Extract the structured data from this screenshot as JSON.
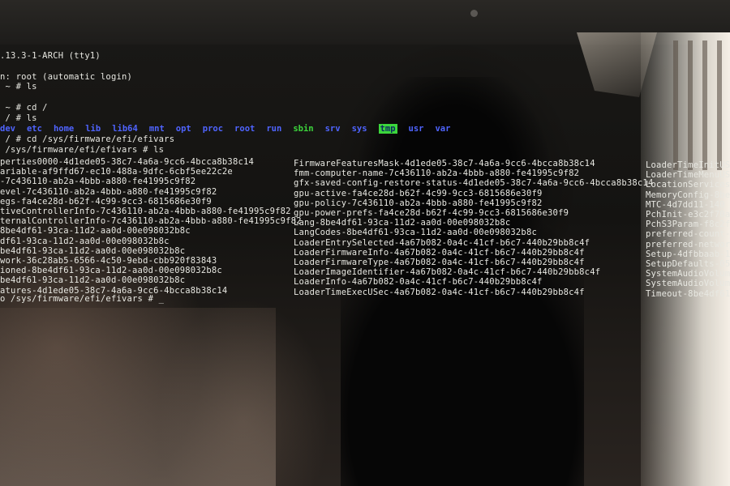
{
  "terminal": {
    "header": [
      ".13.3-1-ARCH (tty1)",
      "n: root (automatic login)",
      " ~ # ls",
      " ~ # cd /",
      " / # ls"
    ],
    "root_listing": [
      {
        "name": "dev",
        "kind": "dir"
      },
      {
        "name": "etc",
        "kind": "dir"
      },
      {
        "name": "home",
        "kind": "dir"
      },
      {
        "name": "lib",
        "kind": "dir"
      },
      {
        "name": "lib64",
        "kind": "dir"
      },
      {
        "name": "mnt",
        "kind": "dir"
      },
      {
        "name": "opt",
        "kind": "dir"
      },
      {
        "name": "proc",
        "kind": "dir"
      },
      {
        "name": "root",
        "kind": "dir"
      },
      {
        "name": "run",
        "kind": "dir"
      },
      {
        "name": "sbin",
        "kind": "exec"
      },
      {
        "name": "srv",
        "kind": "dir"
      },
      {
        "name": "sys",
        "kind": "dir"
      },
      {
        "name": "tmp",
        "kind": "tmp"
      },
      {
        "name": "usr",
        "kind": "dir"
      },
      {
        "name": "var",
        "kind": "dir"
      }
    ],
    "cd_efivars": " / # cd /sys/firmware/efi/efivars",
    "ls_efivars": " /sys/firmware/efi/efivars # ls",
    "col1": [
      "perties0000-4d1ede05-38c7-4a6a-9cc6-4bcca8b38c14",
      "ariable-af9ffd67-ec10-488a-9dfc-6cbf5ee22c2e",
      "-7c436110-ab2a-4bbb-a880-fe41995c9f82",
      "evel-7c436110-ab2a-4bbb-a880-fe41995c9f82",
      "egs-fa4ce28d-b62f-4c99-9cc3-6815686e30f9",
      "tiveControllerInfo-7c436110-ab2a-4bbb-a880-fe41995c9f82",
      "ternalControllerInfo-7c436110-ab2a-4bbb-a880-fe41995c9f82",
      "8be4df61-93ca-11d2-aa0d-00e098032b8c",
      "df61-93ca-11d2-aa0d-00e098032b8c",
      "be4df61-93ca-11d2-aa0d-00e098032b8c",
      "work-36c28ab5-6566-4c50-9ebd-cbb920f83843",
      "ioned-8be4df61-93ca-11d2-aa0d-00e098032b8c",
      "be4df61-93ca-11d2-aa0d-00e098032b8c",
      "atures-4d1ede05-38c7-4a6a-9cc6-4bcca8b38c14"
    ],
    "col2": [
      "FirmwareFeaturesMask-4d1ede05-38c7-4a6a-9cc6-4bcca8b38c14",
      "fmm-computer-name-7c436110-ab2a-4bbb-a880-fe41995c9f82",
      "gfx-saved-config-restore-status-4d1ede05-38c7-4a6a-9cc6-4bcca8b38c14",
      "gpu-active-fa4ce28d-b62f-4c99-9cc3-6815686e30f9",
      "gpu-policy-7c436110-ab2a-4bbb-a880-fe41995c9f82",
      "gpu-power-prefs-fa4ce28d-b62f-4c99-9cc3-6815686e30f9",
      "Lang-8be4df61-93ca-11d2-aa0d-00e098032b8c",
      "LangCodes-8be4df61-93ca-11d2-aa0d-00e098032b8c",
      "LoaderEntrySelected-4a67b082-0a4c-41cf-b6c7-440b29bb8c4f",
      "LoaderFirmwareInfo-4a67b082-0a4c-41cf-b6c7-440b29bb8c4f",
      "LoaderFirmwareType-4a67b082-0a4c-41cf-b6c7-440b29bb8c4f",
      "LoaderImageIdentifier-4a67b082-0a4c-41cf-b6c7-440b29bb8c4f",
      "LoaderInfo-4a67b082-0a4c-41cf-b6c7-440b29bb8c4f",
      "LoaderTimeExecUSec-4a67b082-0a4c-41cf-b6c7-440b29bb8c4f"
    ],
    "col3": [
      "LoaderTimeInitUS",
      "LoaderTimeMenuUS",
      "LocationServices",
      "MemoryConfig-8be",
      "MTC-4d7dd11-140",
      "PchInit-e3c2f70a",
      "PchS3Param-f8c2f7",
      "preferred-count-",
      "preferred-network",
      "Setup-4dfbbaab-13",
      "SetupDefaults-052",
      "SystemAudioVolume",
      "SystemAudioVolume",
      "Timeout-8be4df61-"
    ],
    "prompt": "o /sys/firmware/efi/efivars # ",
    "cursor": "_",
    "colors": {
      "text": "#e8e8e2",
      "dir": "#4f64ff",
      "exec": "#3cd63c",
      "background": "#0b0b0a"
    }
  }
}
